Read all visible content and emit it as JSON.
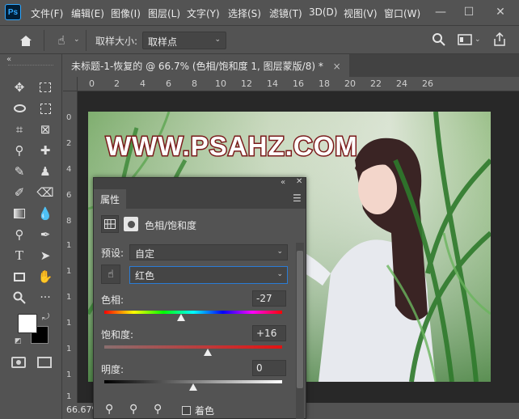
{
  "app": {
    "logo": "Ps"
  },
  "menu": {
    "items": [
      "文件(F)",
      "编辑(E)",
      "图像(I)",
      "图层(L)",
      "文字(Y)",
      "选择(S)",
      "滤镜(T)",
      "3D(D)",
      "视图(V)",
      "窗口(W)"
    ]
  },
  "window_controls": {
    "minimize": "—",
    "maximize": "☐",
    "close": "✕"
  },
  "options": {
    "sample_label": "取样大小:",
    "sample_value": "取样点"
  },
  "document": {
    "tab_title": "未标题-1-恢复的 @ 66.7% (色相/饱和度 1, 图层蒙版/8) *",
    "close": "×",
    "zoom": "66.67%",
    "ruler_h": [
      "0",
      "2",
      "4",
      "6",
      "8",
      "10",
      "12",
      "14",
      "16",
      "18",
      "20",
      "22",
      "24",
      "26"
    ],
    "ruler_v": [
      "0",
      "2",
      "4",
      "6",
      "8",
      "1",
      "1",
      "1",
      "1",
      "1",
      "1",
      "1"
    ],
    "watermark": "WWW.PSAHZ.COM"
  },
  "properties": {
    "tab": "属性",
    "adjustment_title": "色相/饱和度",
    "preset_label": "预设:",
    "preset_value": "自定",
    "channel_value": "红色",
    "hue_label": "色相:",
    "hue_value": "-27",
    "hue_level": 0.43,
    "saturation_label": "饱和度:",
    "saturation_value": "+16",
    "saturation_level": 0.58,
    "lightness_label": "明度:",
    "lightness_value": "0",
    "lightness_level": 0.5,
    "colorize_label": "着色"
  },
  "colors": {
    "accent": "#31a8ff",
    "foreground": "#ffffff",
    "background": "#000000"
  }
}
